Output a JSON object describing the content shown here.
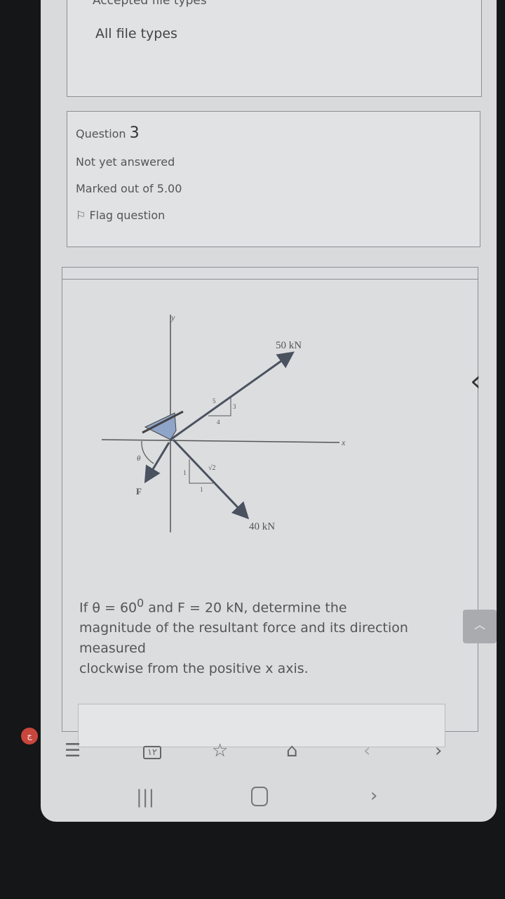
{
  "accepted_file_types": {
    "heading": "Accepted file types",
    "value": "All file types"
  },
  "question_info": {
    "label": "Question",
    "number": "3",
    "status": "Not yet answered",
    "marks": "Marked out of 5.00",
    "flag": "Flag question"
  },
  "diagram": {
    "axis_x": "x",
    "axis_y": "y",
    "force_1": "50 kN",
    "force_2": "40 kN",
    "force_3": "F",
    "angle": "θ",
    "slope_1": {
      "hyp": "5",
      "rise": "3",
      "run": "4"
    },
    "slope_2": {
      "hyp": "√2",
      "rise": "1",
      "run": "1"
    }
  },
  "question_text": {
    "line1_pre": "If θ = 60",
    "line1_sup": "0",
    "line1_post": " and F = 20 kN, determine the",
    "line2": "magnitude of the resultant force and its direction",
    "line3": "measured",
    "line4": "clockwise from the positive x axis."
  },
  "answer": {
    "value": ""
  },
  "browser_nav": {
    "tab_count": "١٢",
    "badge": "ج",
    "icons": [
      "menu-icon",
      "tabs-icon",
      "bookmarks-icon",
      "home-icon",
      "back-icon",
      "forward-icon"
    ]
  },
  "system_nav": {
    "icons": [
      "recents-icon",
      "home-icon",
      "back-icon"
    ]
  }
}
